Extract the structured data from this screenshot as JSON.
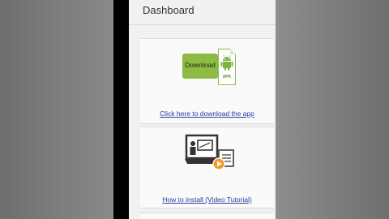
{
  "header": {
    "title": "Dashboard"
  },
  "cards": [
    {
      "button_text": "Download",
      "file_label": "APK",
      "link": "Click here to download the app"
    },
    {
      "link": "How to install (Video Tutorial)"
    }
  ],
  "colors": {
    "accent_green": "#8dbb45",
    "link": "#2a3a9e"
  },
  "icons": [
    "android-icon",
    "video-tutorial-icon",
    "play-icon"
  ]
}
